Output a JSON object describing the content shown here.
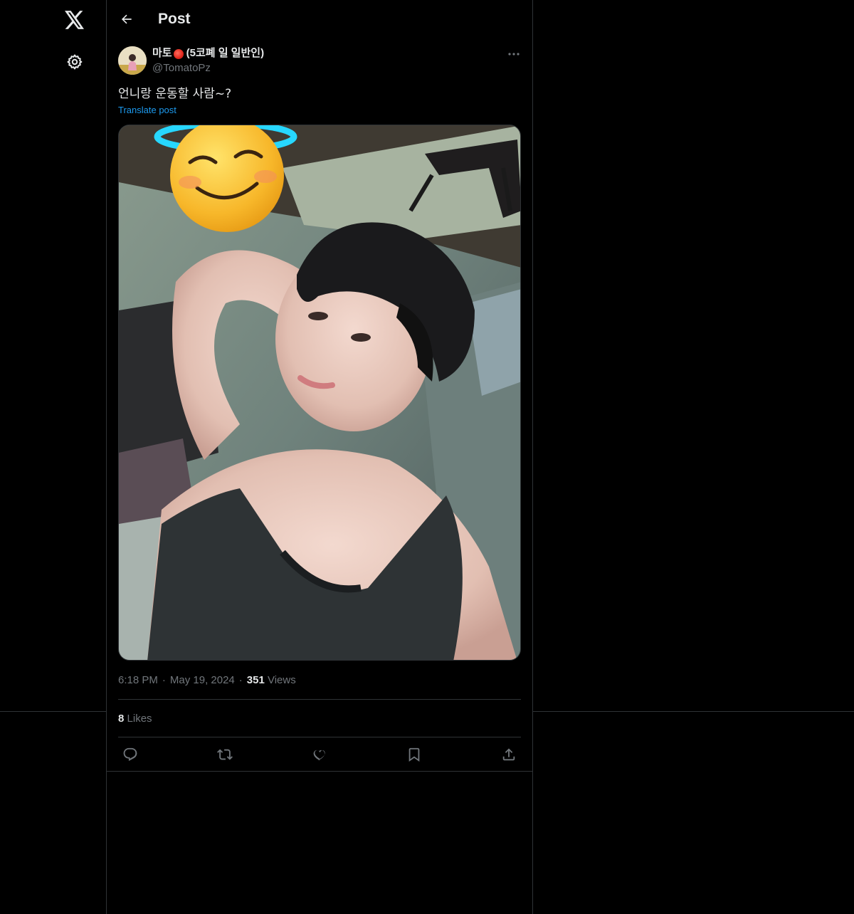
{
  "nav": {
    "logo_icon": "x-logo-icon",
    "settings_icon": "gear-icon"
  },
  "header": {
    "title": "Post",
    "back_icon": "arrow-left-icon"
  },
  "post": {
    "author": {
      "display_name": "마토",
      "display_name_emoji": "tomato",
      "display_name_suffix": "(5코폐 일 일반인)",
      "handle": "@TomatoPz"
    },
    "text": "언니랑 운동할 사람~?",
    "translate_label": "Translate post",
    "time": "6:18 PM",
    "date": "May 19, 2024",
    "views_count": "351",
    "views_label": "Views",
    "likes_count": "8",
    "likes_label": "Likes"
  },
  "actions": [
    {
      "name": "reply",
      "icon": "reply-icon"
    },
    {
      "name": "repost",
      "icon": "repost-icon"
    },
    {
      "name": "like",
      "icon": "heart-icon"
    },
    {
      "name": "bookmark",
      "icon": "bookmark-icon"
    },
    {
      "name": "share",
      "icon": "share-icon"
    }
  ],
  "colors": {
    "background": "#000000",
    "text_primary": "#e7e9ea",
    "text_secondary": "#71767b",
    "link": "#1d9bf0",
    "border": "#2f3336"
  }
}
